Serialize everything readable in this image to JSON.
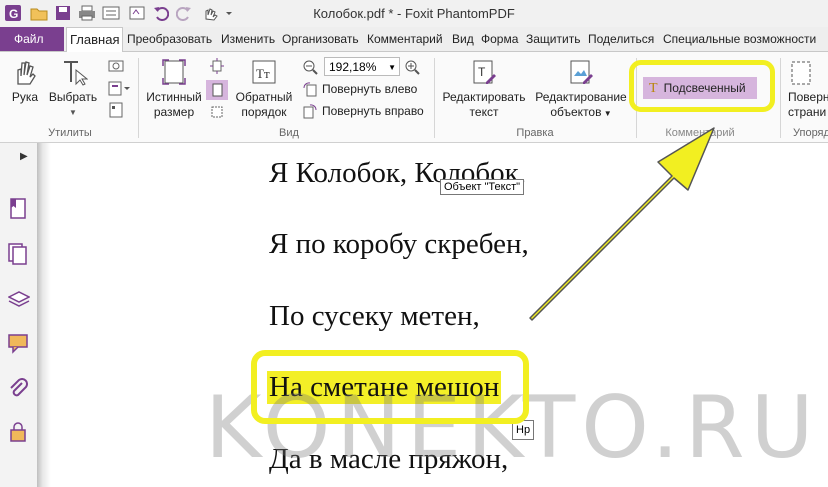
{
  "window": {
    "title": "Колобок.pdf * - Foxit PhantomPDF",
    "app_icon": "foxit-logo-icon"
  },
  "quick_access": [
    "open-folder-icon",
    "save-icon",
    "print-icon",
    "form-icon",
    "undo-icon",
    "redo-icon",
    "hand-dropdown-icon"
  ],
  "tabs": {
    "file": "Файл",
    "items": [
      "Главная",
      "Преобразовать",
      "Изменить",
      "Организовать",
      "Комментарий",
      "Вид",
      "Форма",
      "Защитить",
      "Поделиться",
      "Специальные возможности"
    ],
    "active": "Главная"
  },
  "ribbon": {
    "hand": "Рука",
    "select": "Выбрать",
    "group_utilities": "Утилиты",
    "actual_size_1": "Истинный",
    "actual_size_2": "размер",
    "reverse_1": "Обратный",
    "reverse_2": "порядок",
    "zoom_value": "192,18%",
    "rotate_left": "Повернуть влево",
    "rotate_right": "Повернуть вправо",
    "group_view": "Вид",
    "edit_text_1": "Редактировать",
    "edit_text_2": "текст",
    "edit_objects_1": "Редактирование",
    "edit_objects_2": "объектов",
    "group_edit": "Правка",
    "highlighted": "Подсвеченный",
    "group_comments": "Комментарий",
    "rotate_pages_1": "Поверн",
    "rotate_pages_2": "страни",
    "group_organize": "Упорядо"
  },
  "document": {
    "lines": [
      "Я Колобок, Колобок,",
      "Я по коробу скребен,",
      "По сусеку метен,",
      "На сметане мешон",
      "Да в масле пряжон,"
    ],
    "tooltip_object": "Объект \"Текст\"",
    "tooltip_hp": "Нр"
  },
  "watermark": "KONEKTO.RU",
  "colors": {
    "accent": "#7a3f8f",
    "highlight_button": "#d6b5dd",
    "annotation_yellow": "#f2ef21",
    "text_highlight": "#f3ef27"
  }
}
